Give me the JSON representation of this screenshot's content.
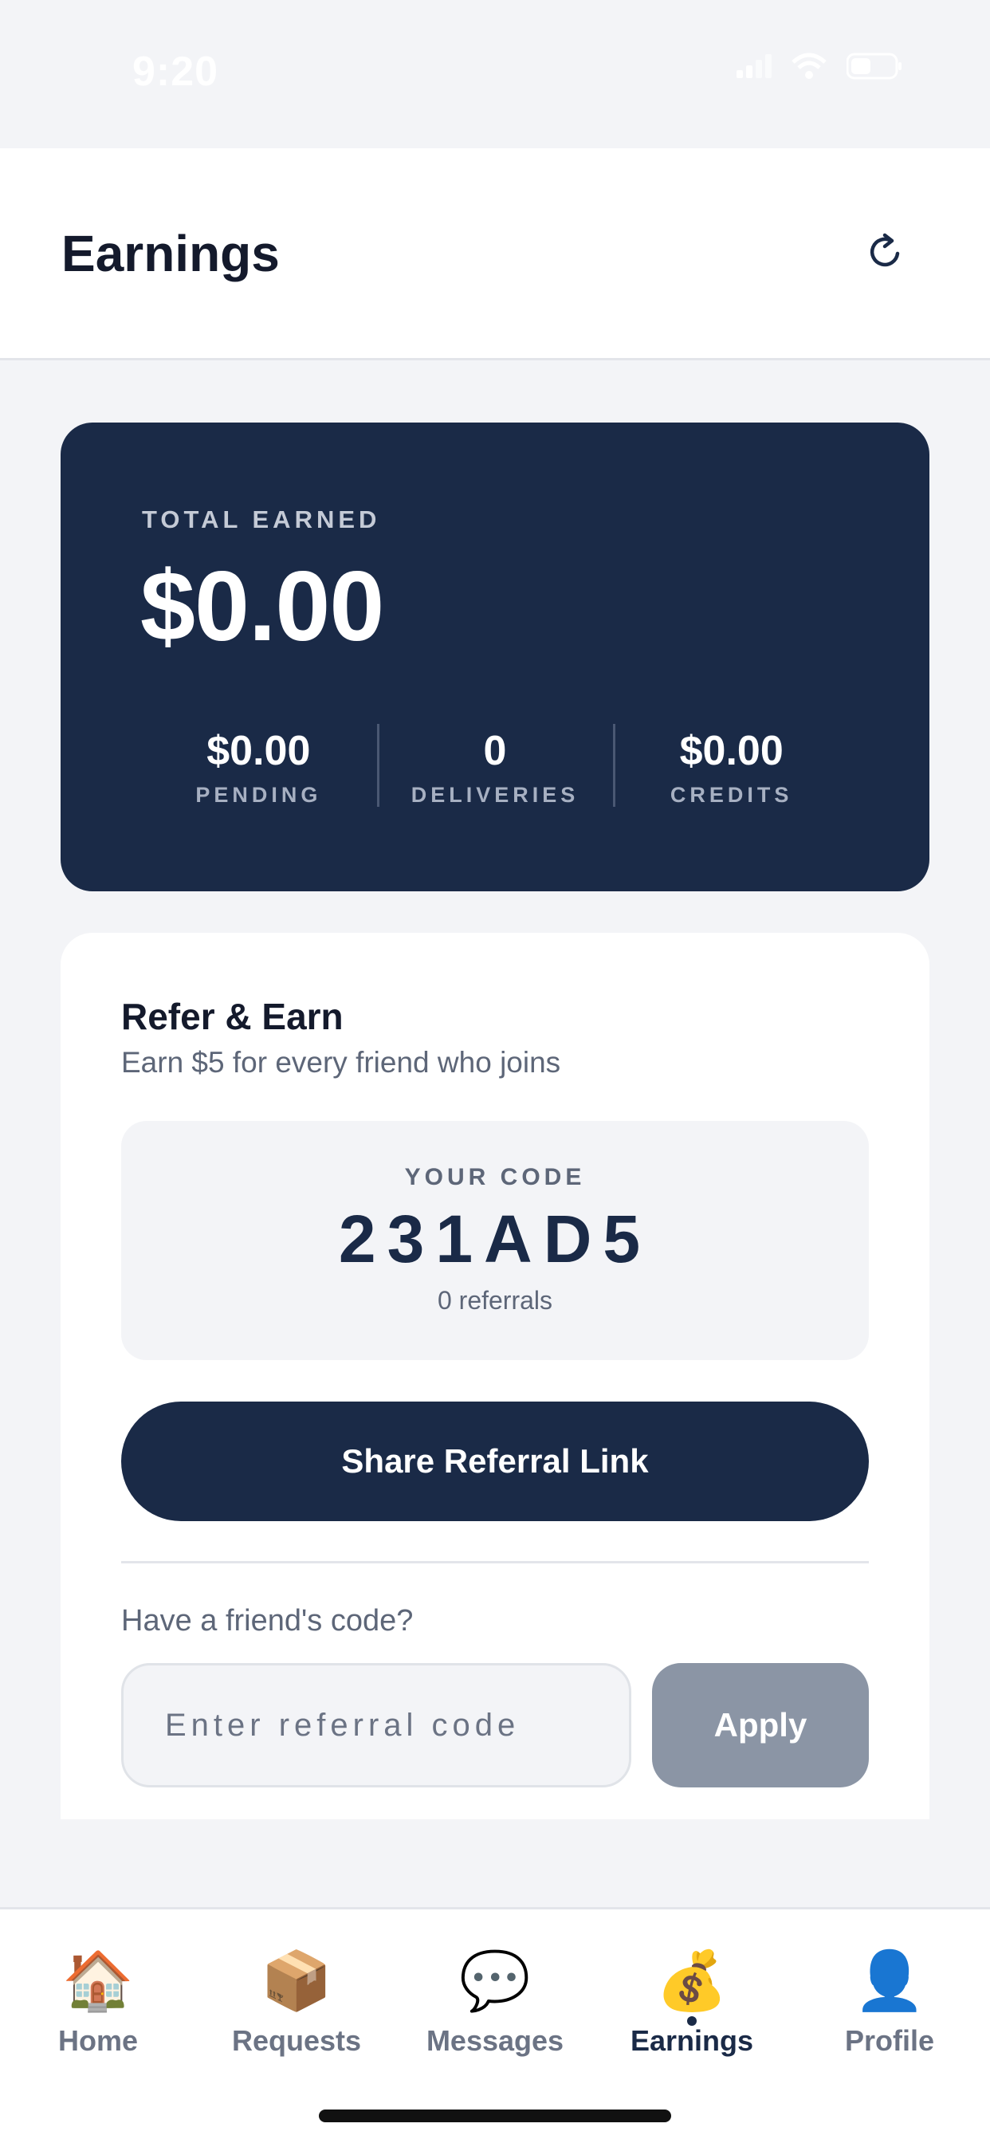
{
  "status_bar": {
    "time": "9:20",
    "icons": [
      "signal-icon",
      "wifi-icon",
      "battery-icon"
    ]
  },
  "header": {
    "title": "Earnings",
    "refresh_icon": "refresh-icon"
  },
  "earnings_card": {
    "label": "TOTAL EARNED",
    "total": "$0.00",
    "stats": [
      {
        "value": "$0.00",
        "label": "PENDING"
      },
      {
        "value": "0",
        "label": "DELIVERIES"
      },
      {
        "value": "$0.00",
        "label": "CREDITS"
      }
    ]
  },
  "referral": {
    "title": "Refer & Earn",
    "subtitle": "Earn $5 for every friend who joins",
    "code_label": "YOUR CODE",
    "code": "231AD5",
    "referral_count": "0 referrals",
    "share_button": "Share Referral Link",
    "friend_prompt": "Have a friend's code?",
    "input_placeholder": "Enter referral code",
    "input_value": "",
    "apply_button": "Apply"
  },
  "tab_bar": {
    "tabs": [
      {
        "label": "Home",
        "icon": "🏠",
        "active": false
      },
      {
        "label": "Requests",
        "icon": "📦",
        "active": false
      },
      {
        "label": "Messages",
        "icon": "💬",
        "active": false
      },
      {
        "label": "Earnings",
        "icon": "💰",
        "active": true
      },
      {
        "label": "Profile",
        "icon": "👤",
        "active": false
      }
    ]
  },
  "colors": {
    "navy": "#1a2a47",
    "background": "#f3f4f7",
    "muted_text": "#5d6678",
    "disabled_button": "#8b95a5"
  }
}
